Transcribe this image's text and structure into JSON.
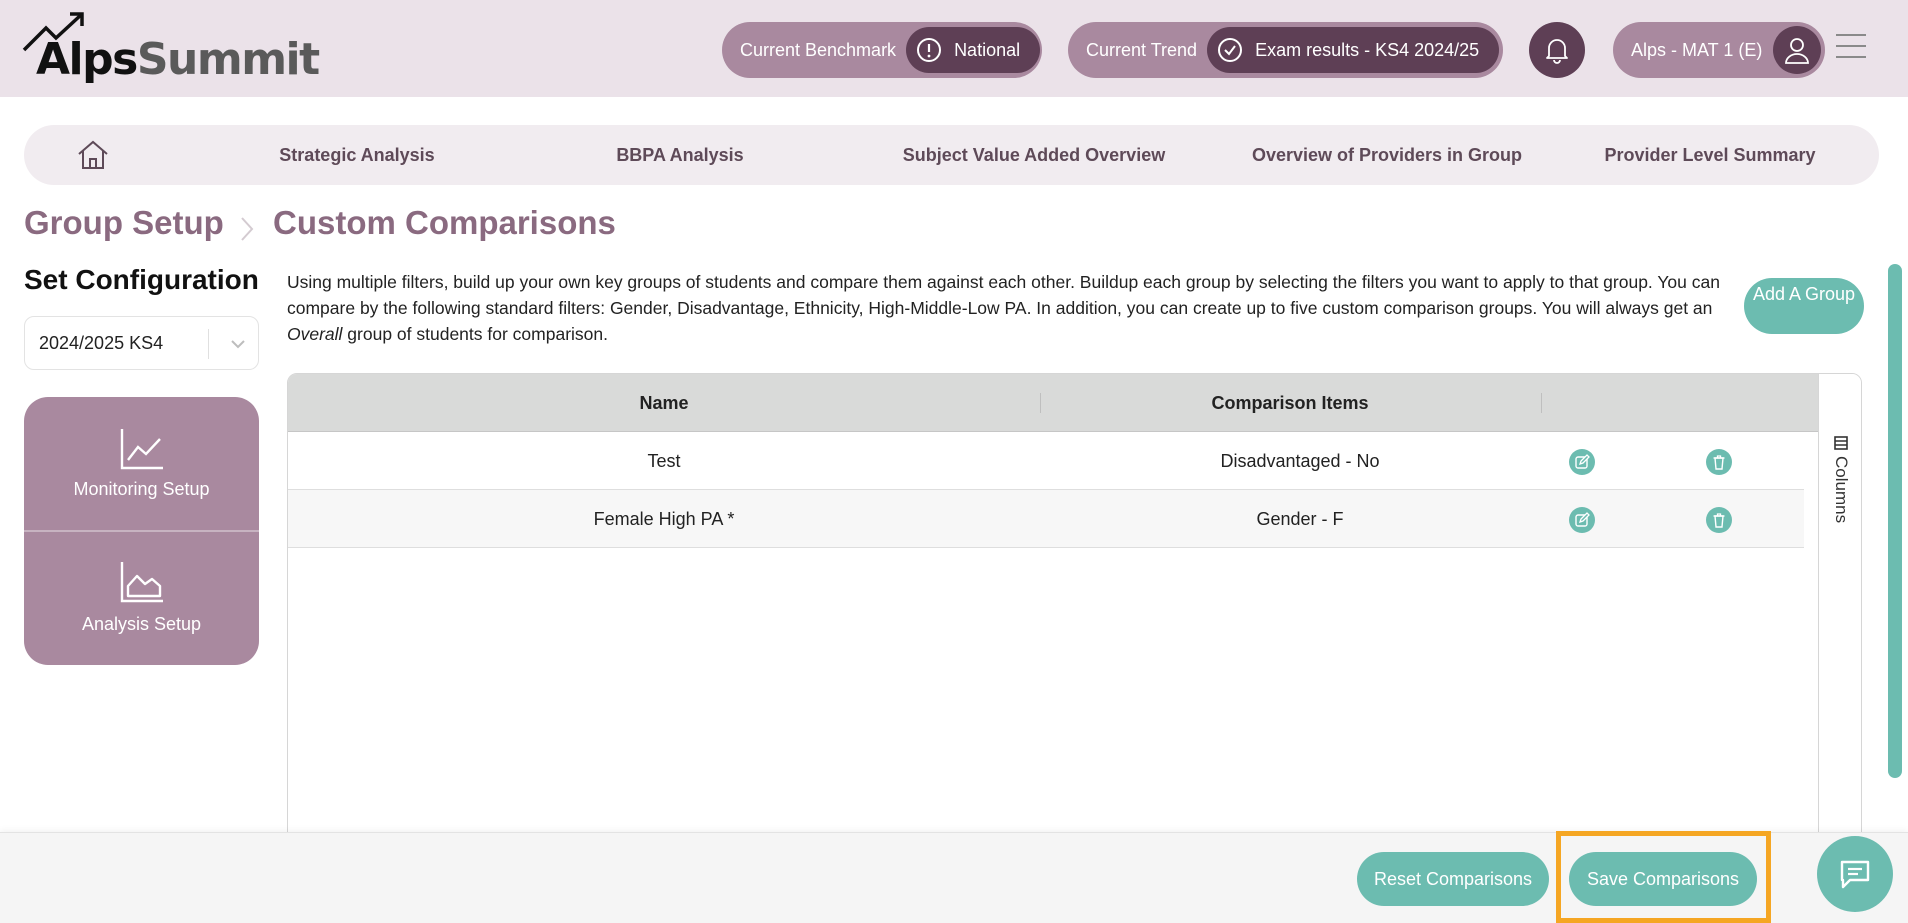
{
  "app": {
    "logo_alps": "Alps",
    "logo_summit": "Summit"
  },
  "header": {
    "benchmark_label": "Current Benchmark",
    "benchmark_value": "National",
    "trend_label": "Current Trend",
    "trend_value": "Exam results - KS4 2024/25",
    "user_label": "Alps - MAT 1 (E)"
  },
  "nav": {
    "items": [
      {
        "label": "Strategic Analysis"
      },
      {
        "label": "BBPA Analysis"
      },
      {
        "label": "Subject Value Added Overview"
      },
      {
        "label": "Overview of Providers in Group"
      },
      {
        "label": "Provider Level Summary"
      }
    ]
  },
  "breadcrumb": {
    "parent": "Group Setup",
    "current": "Custom Comparisons"
  },
  "sidebar": {
    "title": "Set Configuration",
    "year_select": "2024/2025 KS4",
    "items": [
      {
        "label": "Monitoring Setup",
        "icon": "line-chart-icon"
      },
      {
        "label": "Analysis Setup",
        "icon": "area-chart-icon"
      }
    ]
  },
  "main": {
    "description_part1": "Using multiple filters, build up your own key groups of students and compare them against each other. Buildup each group by selecting the filters you want to apply to that group. You can compare by the following standard filters: Gender, Disadvantage, Ethnicity, High-Middle-Low PA. In addition, you can create up to five custom comparison groups. You will always get an ",
    "description_em": "Overall",
    "description_part2": " group of students for comparison.",
    "add_group_label": "Add A Group",
    "table": {
      "columns": [
        "Name",
        "Comparison Items"
      ],
      "rows": [
        {
          "name": "Test",
          "items": "Disadvantaged - No"
        },
        {
          "name": "Female High PA *",
          "items": "Gender - F"
        }
      ],
      "side_label": "Columns"
    }
  },
  "footer": {
    "reset_label": "Reset Comparisons",
    "save_label": "Save Comparisons"
  },
  "colors": {
    "accent_teal": "#6cbcb0",
    "plum_dark": "#5e3f55",
    "plum_light": "#a9899f",
    "header_bg": "#ebe2e9",
    "highlight": "#f5a623"
  }
}
